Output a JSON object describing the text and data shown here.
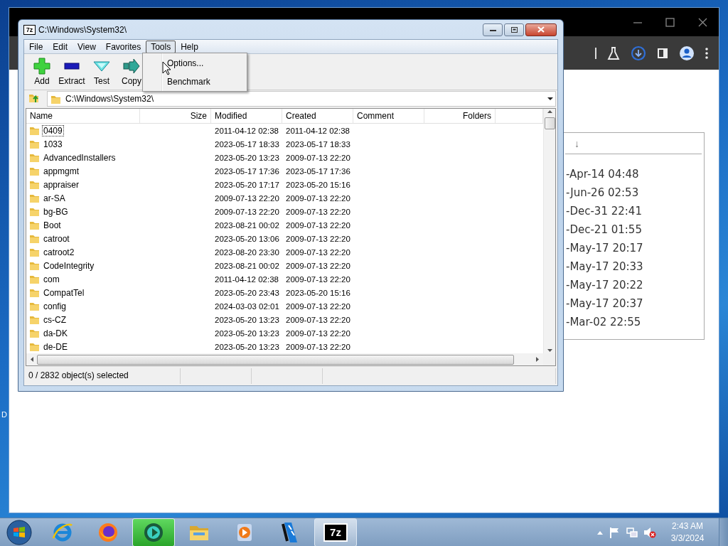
{
  "desktop": {
    "edge_label": "D"
  },
  "browser": {
    "panel": {
      "header": "↓",
      "rows": [
        "-Apr-14 04:48",
        "-Jun-26 02:53",
        "-Dec-31 22:41",
        "-Dec-21 01:55",
        "-May-17 20:17",
        "-May-17 20:33",
        "-May-17 20:22",
        "-May-17 20:37",
        "-Mar-02 22:55"
      ]
    }
  },
  "window": {
    "icon_text": "7z",
    "title": "C:\\Windows\\System32\\",
    "menu": [
      {
        "label": "File",
        "selected": false
      },
      {
        "label": "Edit",
        "selected": false
      },
      {
        "label": "View",
        "selected": false
      },
      {
        "label": "Favorites",
        "selected": false
      },
      {
        "label": "Tools",
        "selected": true
      },
      {
        "label": "Help",
        "selected": false
      }
    ],
    "open_menu": [
      "Options...",
      "Benchmark"
    ],
    "toolbar": [
      {
        "kind": "add",
        "label": "Add"
      },
      {
        "kind": "extract",
        "label": "Extract"
      },
      {
        "kind": "test",
        "label": "Test"
      },
      {
        "kind": "copy",
        "label": "Copy"
      }
    ],
    "address": "C:\\Windows\\System32\\",
    "columns": [
      "Name",
      "Size",
      "Modified",
      "Created",
      "Comment",
      "Folders"
    ],
    "rows": [
      {
        "name": "0409",
        "modified": "2011-04-12 02:38",
        "created": "2011-04-12 02:38",
        "focused": true
      },
      {
        "name": "1033",
        "modified": "2023-05-17 18:33",
        "created": "2023-05-17 18:33",
        "focused": false
      },
      {
        "name": "AdvancedInstallers",
        "modified": "2023-05-20 13:23",
        "created": "2009-07-13 22:20",
        "focused": false
      },
      {
        "name": "appmgmt",
        "modified": "2023-05-17 17:36",
        "created": "2023-05-17 17:36",
        "focused": false
      },
      {
        "name": "appraiser",
        "modified": "2023-05-20 17:17",
        "created": "2023-05-20 15:16",
        "focused": false
      },
      {
        "name": "ar-SA",
        "modified": "2009-07-13 22:20",
        "created": "2009-07-13 22:20",
        "focused": false
      },
      {
        "name": "bg-BG",
        "modified": "2009-07-13 22:20",
        "created": "2009-07-13 22:20",
        "focused": false
      },
      {
        "name": "Boot",
        "modified": "2023-08-21 00:02",
        "created": "2009-07-13 22:20",
        "focused": false
      },
      {
        "name": "catroot",
        "modified": "2023-05-20 13:06",
        "created": "2009-07-13 22:20",
        "focused": false
      },
      {
        "name": "catroot2",
        "modified": "2023-08-20 23:30",
        "created": "2009-07-13 22:20",
        "focused": false
      },
      {
        "name": "CodeIntegrity",
        "modified": "2023-08-21 00:02",
        "created": "2009-07-13 22:20",
        "focused": false
      },
      {
        "name": "com",
        "modified": "2011-04-12 02:38",
        "created": "2009-07-13 22:20",
        "focused": false
      },
      {
        "name": "CompatTel",
        "modified": "2023-05-20 23:43",
        "created": "2023-05-20 15:16",
        "focused": false
      },
      {
        "name": "config",
        "modified": "2024-03-03 02:01",
        "created": "2009-07-13 22:20",
        "focused": false
      },
      {
        "name": "cs-CZ",
        "modified": "2023-05-20 13:23",
        "created": "2009-07-13 22:20",
        "focused": false
      },
      {
        "name": "da-DK",
        "modified": "2023-05-20 13:23",
        "created": "2009-07-13 22:20",
        "focused": false
      },
      {
        "name": "de-DE",
        "modified": "2023-05-20 13:23",
        "created": "2009-07-13 22:20",
        "focused": false
      }
    ],
    "status": "0 / 2832 object(s) selected"
  },
  "taskbar": {
    "apps": [
      {
        "kind": "e-browser",
        "active": false
      },
      {
        "kind": "firefox",
        "active": false
      },
      {
        "kind": "circle-app",
        "active": true
      },
      {
        "kind": "folders",
        "active": false
      },
      {
        "kind": "media",
        "active": false
      },
      {
        "kind": "film",
        "active": false
      },
      {
        "kind": "archiver",
        "active": true,
        "label": "7z"
      }
    ],
    "clock": {
      "time": "2:43 AM",
      "date": "3/3/2024"
    }
  }
}
